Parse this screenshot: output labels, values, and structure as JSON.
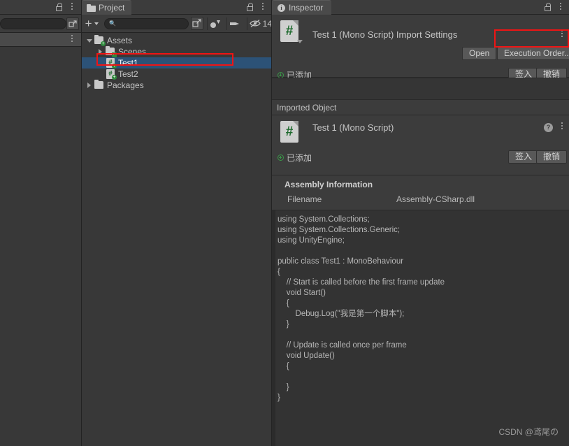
{
  "left_panel": {
    "lock_icon": "lock-icon",
    "kebab_icon": "kebab-menu-icon",
    "expand_icon": "expand-icon",
    "kebab_icon2": "kebab-menu-icon"
  },
  "project_panel": {
    "tab_label": "Project",
    "tab_icon": "folder-icon",
    "lock_icon": "lock-icon",
    "kebab_icon": "kebab-menu-icon",
    "toolbar": {
      "create_label": "+",
      "create_icon": "plus-icon",
      "dropdown_icon": "chevron-down-icon",
      "search_placeholder": "",
      "search_value": "",
      "search_icon": "search-icon",
      "expand_icon": "expand-window-icon",
      "type_filter_icon": "filter-by-type-icon",
      "label_filter_icon": "filter-by-label-icon",
      "hidden_icon": "eye-crossed-icon",
      "hidden_count": "14"
    },
    "tree": [
      {
        "label": "Assets",
        "indent": 0,
        "arrow": "down",
        "icon": "folder-icon",
        "badge": "add",
        "selected": false
      },
      {
        "label": "Scenes",
        "indent": 1,
        "arrow": "right",
        "icon": "folder-icon",
        "badge": "check",
        "selected": false
      },
      {
        "label": "Test1",
        "indent": 1,
        "arrow": "none",
        "icon": "script-icon",
        "badge": "add",
        "selected": true
      },
      {
        "label": "Test2",
        "indent": 1,
        "arrow": "none",
        "icon": "script-icon",
        "badge": "add",
        "selected": false
      },
      {
        "label": "Packages",
        "indent": 0,
        "arrow": "right",
        "icon": "folder-icon",
        "badge": "none",
        "selected": false
      }
    ]
  },
  "inspector": {
    "tab_label": "Inspector",
    "tab_icon": "info-icon",
    "lock_icon": "lock-icon",
    "kebab_icon": "kebab-menu-icon",
    "importer": {
      "title": "Test 1 (Mono Script) Import Settings",
      "script_icon": "csharp-script-icon",
      "kebab_icon": "kebab-menu-icon",
      "open_label": "Open",
      "execution_order_label": "Execution Order...",
      "vcs_status": "已添加",
      "vcs_icon": "vcs-added-icon",
      "checkin_label": "签入",
      "revert_label": "撤销"
    },
    "imported_object_label": "Imported Object",
    "object_header": {
      "title": "Test 1 (Mono Script)",
      "script_icon": "csharp-script-icon",
      "help_icon": "help-icon",
      "help_glyph": "?",
      "kebab_icon": "kebab-menu-icon",
      "vcs_status": "已添加",
      "vcs_icon": "vcs-added-icon",
      "checkin_label": "签入",
      "revert_label": "撤销"
    },
    "assembly": {
      "section_title": "Assembly Information",
      "filename_key": "Filename",
      "filename_value": "Assembly-CSharp.dll"
    },
    "code_preview": "using System.Collections;\nusing System.Collections.Generic;\nusing UnityEngine;\n\npublic class Test1 : MonoBehaviour\n{\n    // Start is called before the first frame update\n    void Start()\n    {\n        Debug.Log(\"我是第一个脚本\");\n    }\n\n    // Update is called once per frame\n    void Update()\n    {\n\n    }\n}"
  },
  "watermark": "CSDN @鸢尾の",
  "annotations": {
    "accent_color": "#f01414",
    "selection_color": "#2c5277"
  }
}
